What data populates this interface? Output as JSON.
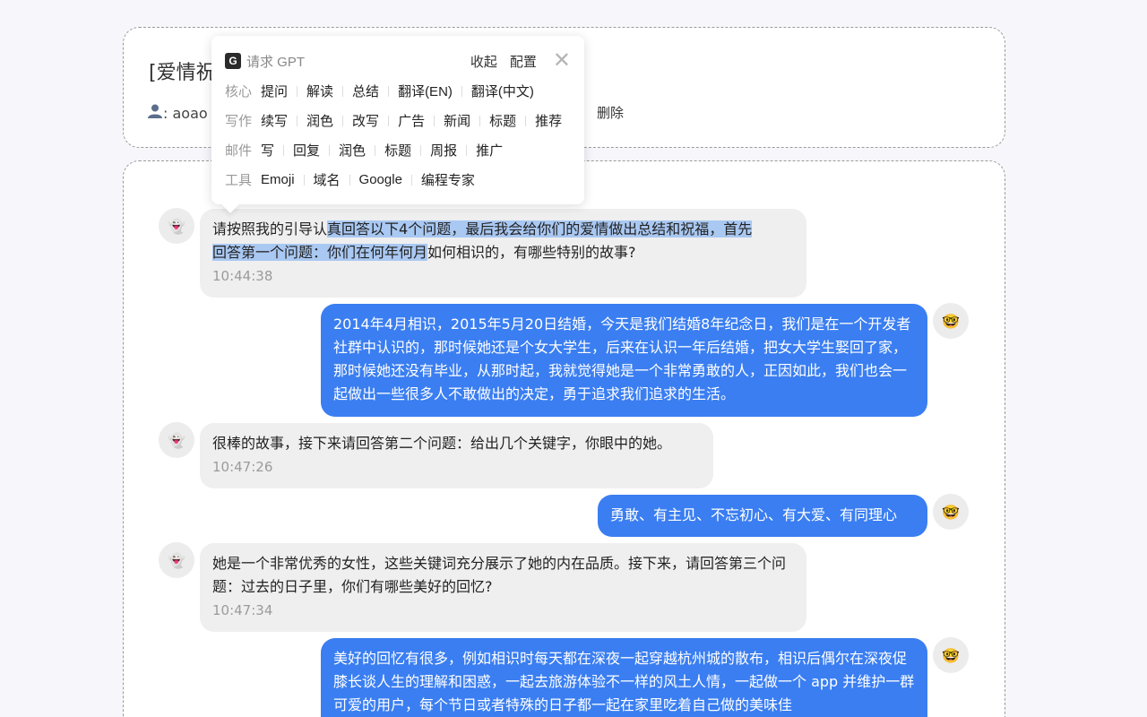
{
  "header": {
    "title": "[爱情祝",
    "user_icon": "user-icon",
    "user_text": ": aoao",
    "delete_label": "删除"
  },
  "popup": {
    "logo": "G",
    "title": "请求 GPT",
    "collapse": "收起",
    "config": "配置",
    "close": "✕",
    "rows": [
      {
        "category": "核心",
        "items": [
          "提问",
          "解读",
          "总结",
          "翻译(EN)",
          "翻译(中文)"
        ]
      },
      {
        "category": "写作",
        "items": [
          "续写",
          "润色",
          "改写",
          "广告",
          "新闻",
          "标题",
          "推荐"
        ]
      },
      {
        "category": "邮件",
        "items": [
          "写",
          "回复",
          "润色",
          "标题",
          "周报",
          "推广"
        ]
      },
      {
        "category": "工具",
        "items": [
          "Emoji",
          "域名",
          "Google",
          "编程专家"
        ]
      }
    ]
  },
  "messages": [
    {
      "role": "bot",
      "avatar": "👻",
      "line1_pre": "请按照我的引导认",
      "line1_hl": "真回答以下4个问题，最后我会给你们的爱情做出总结和祝福，首先",
      "line2_hl": "回答第一个问题：你们在何年何月",
      "line2_post": "如何相识的，有哪些特别的故事?",
      "time": "10:44:38"
    },
    {
      "role": "user",
      "avatar": "🤓",
      "text": "2014年4月相识，2015年5月20日结婚，今天是我们结婚8年纪念日，我们是在一个开发者社群中认识的，那时候她还是个女大学生，后来在认识一年后结婚，把女大学生娶回了家，那时候她还没有毕业，从那时起，我就觉得她是一个非常勇敢的人，正因如此，我们也会一起做出一些很多人不敢做出的决定，勇于追求我们追求的生活。"
    },
    {
      "role": "bot",
      "avatar": "👻",
      "text": "很棒的故事，接下来请回答第二个问题：给出几个关键字，你眼中的她。",
      "time": "10:47:26"
    },
    {
      "role": "user",
      "avatar": "🤓",
      "text": "勇敢、有主见、不忘初心、有大爱、有同理心"
    },
    {
      "role": "bot",
      "avatar": "👻",
      "text": "她是一个非常优秀的女性，这些关键词充分展示了她的内在品质。接下来，请回答第三个问题：过去的日子里，你们有哪些美好的回忆?",
      "time": "10:47:34"
    },
    {
      "role": "user",
      "avatar": "🤓",
      "text": "美好的回忆有很多，例如相识时每天都在深夜一起穿越杭州城的散布，相识后偶尔在深夜促膝长谈人生的理解和困惑，一起去旅游体验不一样的风土人情，一起做一个 app 并维护一群可爱的用户，每个节日或者特殊的日子都一起在家里吃着自己做的美味佳"
    }
  ]
}
